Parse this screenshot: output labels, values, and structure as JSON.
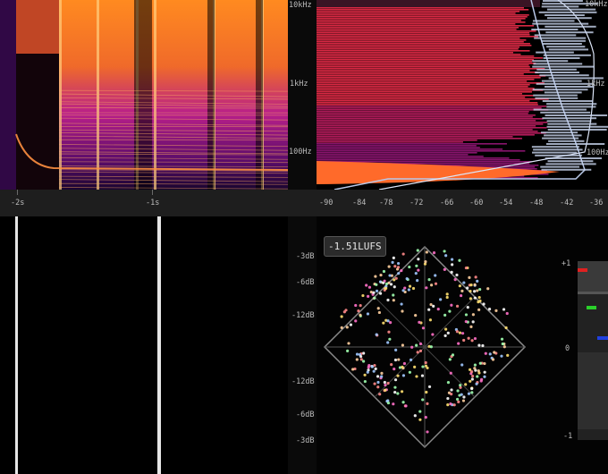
{
  "spectrogram": {
    "freq_labels": [
      "10kHz",
      "1kHz",
      "100Hz"
    ]
  },
  "spectrum": {
    "freq_labels": [
      "10kHz",
      "1kHz",
      "100Hz"
    ]
  },
  "time_ruler": {
    "labels": [
      "-2s",
      "-1s"
    ]
  },
  "db_ruler": {
    "labels": [
      "-90",
      "-84",
      "-78",
      "-72",
      "-66",
      "-60",
      "-54",
      "-48",
      "-42",
      "-36"
    ]
  },
  "waveform": {
    "db_labels": [
      "-3dB",
      "-6dB",
      "-12dB",
      "-12dB",
      "-6dB",
      "-3dB"
    ]
  },
  "stereo": {
    "lufs_readout": "-1.51LUFS",
    "correlation_labels": [
      "+1",
      "0",
      "-1"
    ]
  },
  "colors": {
    "background": "#000000",
    "ruler": "#1e1e1e",
    "spectrogram_hot": "#ff9a2e",
    "spectrogram_mid": "#c2188f",
    "spectrogram_cold": "#2a0a5e",
    "waveform_pink": "#ff8fe0",
    "waveform_blue": "#5aa0ff",
    "meter_red": "#e02020",
    "meter_green": "#2ad02a",
    "meter_blue": "#2040e0"
  }
}
